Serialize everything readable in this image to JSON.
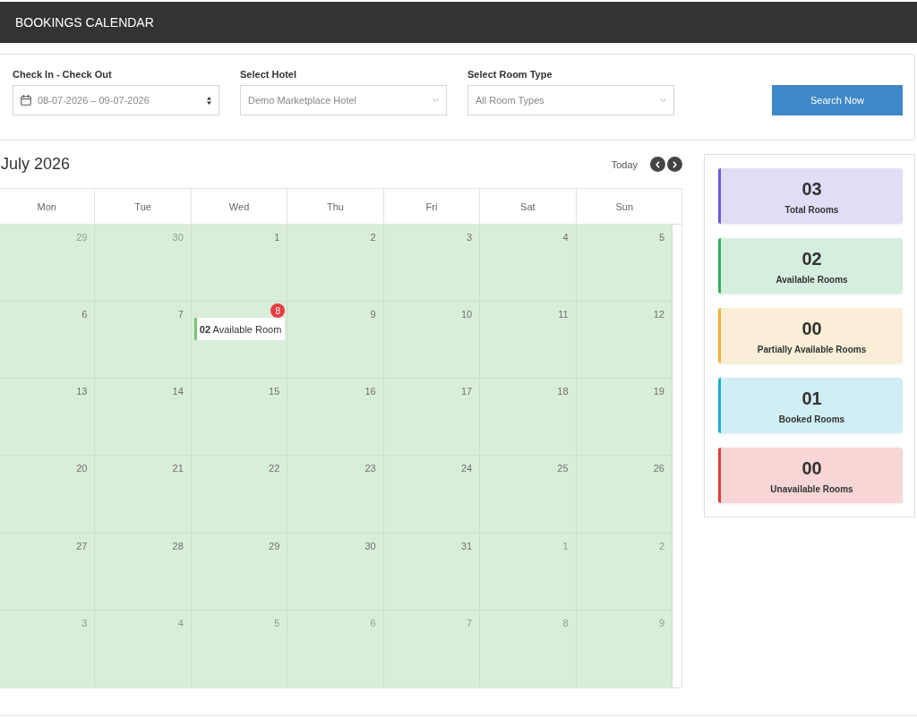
{
  "header": {
    "title": "BOOKINGS CALENDAR"
  },
  "filters": {
    "fields": [
      {
        "kind": "date",
        "label": "Check In - Check Out",
        "value": "08-07-2026 – 09-07-2026"
      },
      {
        "kind": "select",
        "label": "Select Hotel",
        "value": "Demo Marketplace Hotel"
      },
      {
        "kind": "select",
        "label": "Select Room Type",
        "value": "All Room Types"
      }
    ],
    "search_button": "Search Now"
  },
  "calendar": {
    "title": "July 2026",
    "today_button": "Today",
    "weekdays": [
      "Mon",
      "Tue",
      "Wed",
      "Thu",
      "Fri",
      "Sat",
      "Sun"
    ],
    "weeks": [
      [
        {
          "day": "29",
          "other_month": true,
          "today": false
        },
        {
          "day": "30",
          "other_month": true,
          "today": false
        },
        {
          "day": "1",
          "other_month": false,
          "today": false
        },
        {
          "day": "2",
          "other_month": false,
          "today": false
        },
        {
          "day": "3",
          "other_month": false,
          "today": false
        },
        {
          "day": "4",
          "other_month": false,
          "today": false
        },
        {
          "day": "5",
          "other_month": false,
          "today": false
        }
      ],
      [
        {
          "day": "6",
          "other_month": false,
          "today": false
        },
        {
          "day": "7",
          "other_month": false,
          "today": false
        },
        {
          "day": "8",
          "other_month": false,
          "today": true,
          "events": [
            {
              "text": "**02** Available Room"
            }
          ]
        },
        {
          "day": "9",
          "other_month": false,
          "today": false
        },
        {
          "day": "10",
          "other_month": false,
          "today": false
        },
        {
          "day": "11",
          "other_month": false,
          "today": false
        },
        {
          "day": "12",
          "other_month": false,
          "today": false
        }
      ],
      [
        {
          "day": "13",
          "other_month": false,
          "today": false
        },
        {
          "day": "14",
          "other_month": false,
          "today": false
        },
        {
          "day": "15",
          "other_month": false,
          "today": false
        },
        {
          "day": "16",
          "other_month": false,
          "today": false
        },
        {
          "day": "17",
          "other_month": false,
          "today": false
        },
        {
          "day": "18",
          "other_month": false,
          "today": false
        },
        {
          "day": "19",
          "other_month": false,
          "today": false
        }
      ],
      [
        {
          "day": "20",
          "other_month": false,
          "today": false
        },
        {
          "day": "21",
          "other_month": false,
          "today": false
        },
        {
          "day": "22",
          "other_month": false,
          "today": false
        },
        {
          "day": "23",
          "other_month": false,
          "today": false
        },
        {
          "day": "24",
          "other_month": false,
          "today": false
        },
        {
          "day": "25",
          "other_month": false,
          "today": false
        },
        {
          "day": "26",
          "other_month": false,
          "today": false
        }
      ],
      [
        {
          "day": "27",
          "other_month": false,
          "today": false
        },
        {
          "day": "28",
          "other_month": false,
          "today": false
        },
        {
          "day": "29",
          "other_month": false,
          "today": false
        },
        {
          "day": "30",
          "other_month": false,
          "today": false
        },
        {
          "day": "31",
          "other_month": false,
          "today": false
        },
        {
          "day": "1",
          "other_month": true,
          "today": false
        },
        {
          "day": "2",
          "other_month": true,
          "today": false
        }
      ],
      [
        {
          "day": "3",
          "other_month": true,
          "today": false
        },
        {
          "day": "4",
          "other_month": true,
          "today": false
        },
        {
          "day": "5",
          "other_month": true,
          "today": false
        },
        {
          "day": "6",
          "other_month": true,
          "today": false
        },
        {
          "day": "7",
          "other_month": true,
          "today": false
        },
        {
          "day": "8",
          "other_month": true,
          "today": false
        },
        {
          "day": "9",
          "other_month": true,
          "today": false
        }
      ]
    ]
  },
  "stats": [
    {
      "value": "03",
      "label": "Total Rooms",
      "color": "#6a5bd6"
    },
    {
      "value": "02",
      "label": "Available Rooms",
      "color": "#35ad63"
    },
    {
      "value": "00",
      "label": "Partially Available Rooms",
      "color": "#e9b43c"
    },
    {
      "value": "01",
      "label": "Booked Rooms",
      "color": "#1fb0c8"
    },
    {
      "value": "00",
      "label": "Unavailable Rooms",
      "color": "#e03c3c"
    }
  ]
}
